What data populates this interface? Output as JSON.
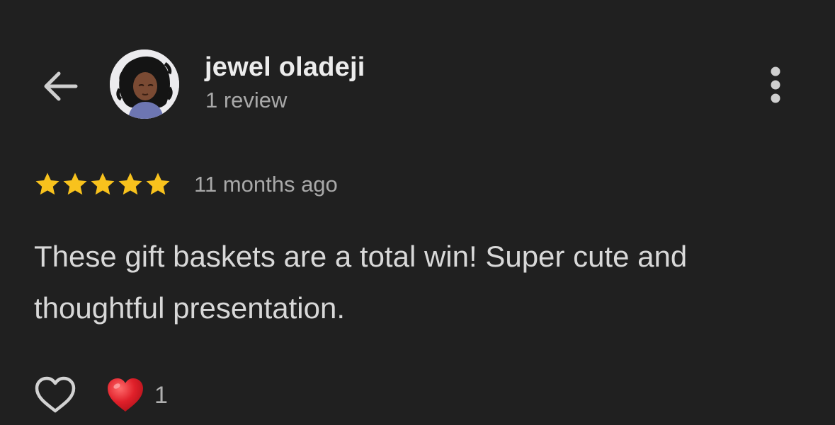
{
  "header": {
    "back_icon": "arrow-left-icon",
    "user_name": "jewel oladeji",
    "review_count": "1 review",
    "more_icon": "more-vertical-icon"
  },
  "review": {
    "rating": 5,
    "rating_max": 5,
    "star_color": "#F8C21D",
    "timestamp": "11 months ago",
    "text": "These gift baskets are a total win! Super cute and thoughtful presentation."
  },
  "actions": {
    "like_icon": "heart-outline-icon",
    "reaction_icon": "red-heart-icon",
    "reaction_color": "#E0202A",
    "reaction_count": "1"
  },
  "colors": {
    "background": "#202020",
    "primary_text": "#ECECEC",
    "secondary_text": "#A9A9A9"
  }
}
